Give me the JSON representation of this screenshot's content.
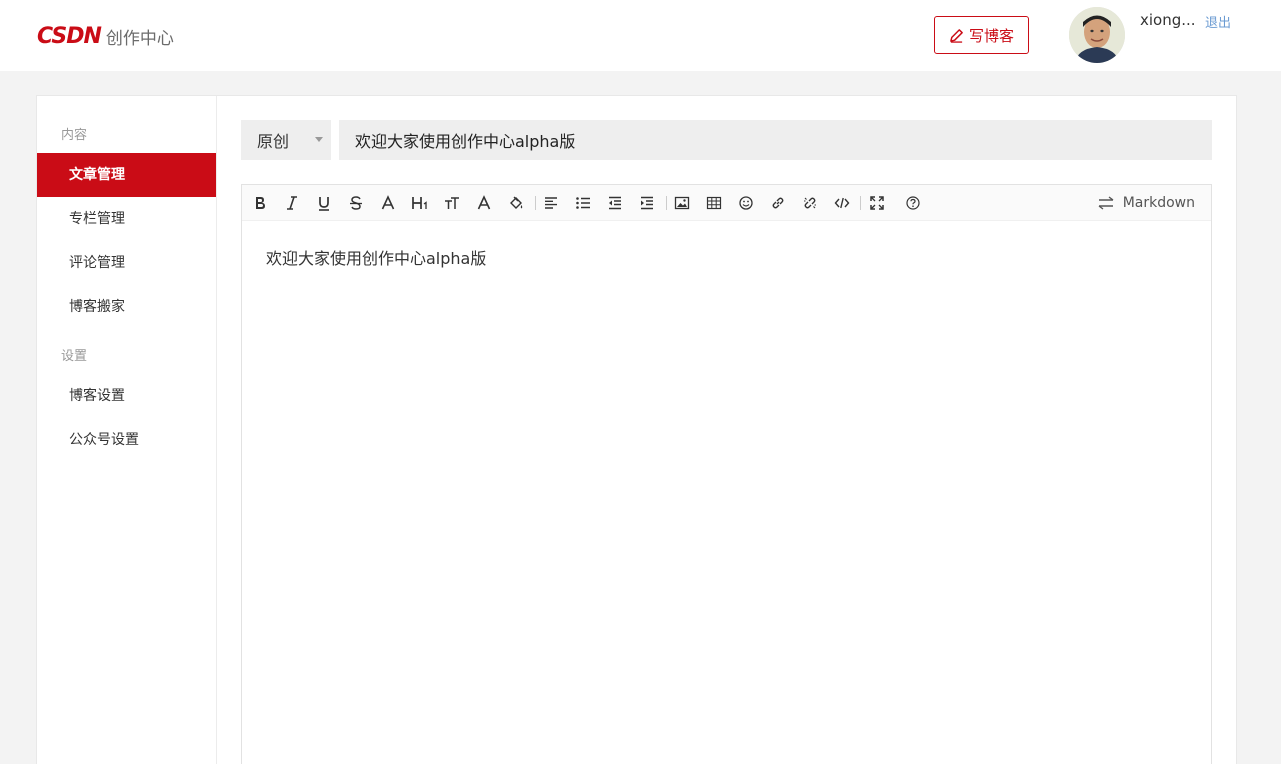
{
  "header": {
    "logo_text": "CSDN",
    "logo_subtitle": "创作中心",
    "write_label": "写博客",
    "username": "xiong...",
    "logout_label": "退出"
  },
  "sidebar": {
    "groups": [
      {
        "label": "内容",
        "items": [
          "文章管理",
          "专栏管理",
          "评论管理",
          "博客搬家"
        ]
      },
      {
        "label": "设置",
        "items": [
          "博客设置",
          "公众号设置"
        ]
      }
    ],
    "active_item": "文章管理"
  },
  "editor": {
    "article_type": "原创",
    "title_value": "欢迎大家使用创作中心alpha版",
    "mode_label": "Markdown",
    "body_text": "欢迎大家使用创作中心alpha版",
    "toolbar_icons": [
      "bold-icon",
      "italic-icon",
      "underline-icon",
      "strikethrough-icon",
      "font-icon",
      "heading-icon",
      "font-size-icon",
      "font-color-icon",
      "background-color-icon",
      "align-left-icon",
      "unordered-list-icon",
      "outdent-icon",
      "indent-icon",
      "image-icon",
      "table-icon",
      "emoji-icon",
      "link-icon",
      "unlink-icon",
      "code-icon",
      "fullscreen-icon",
      "help-icon"
    ]
  },
  "colors": {
    "brand": "#ca0c16",
    "background": "#f3f3f3",
    "input_bg": "#eeeeee"
  }
}
